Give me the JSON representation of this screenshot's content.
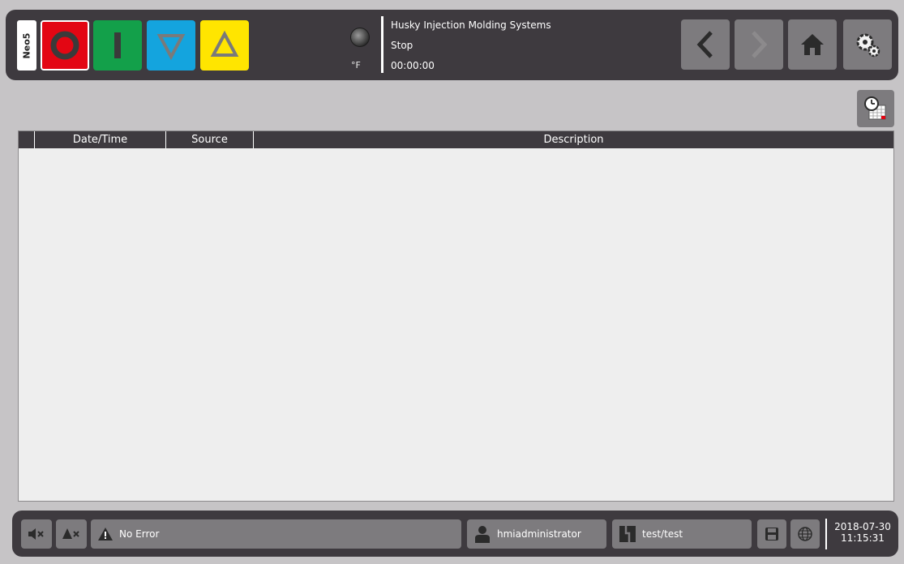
{
  "header": {
    "machine_tag": "Neo5",
    "temperature_unit": "°F",
    "company": "Husky Injection Molding Systems",
    "machine_state": "Stop",
    "cycle_time": "00:00:00",
    "mode_colors": {
      "stop": "#e30613",
      "run": "#13a04a",
      "down": "#14a4de",
      "up": "#ffe500"
    }
  },
  "nav": {
    "back_icon": "chevron-left-icon",
    "forward_icon": "chevron-right-icon",
    "home_icon": "home-icon",
    "settings_icon": "gears-icon"
  },
  "table": {
    "columns": [
      "",
      "Date/Time",
      "Source",
      "Description"
    ],
    "rows": []
  },
  "footer": {
    "alarm_status": "No Error",
    "user": "hmiadministrator",
    "mold": "test/test",
    "date": "2018-07-30",
    "time": "11:15:31"
  }
}
